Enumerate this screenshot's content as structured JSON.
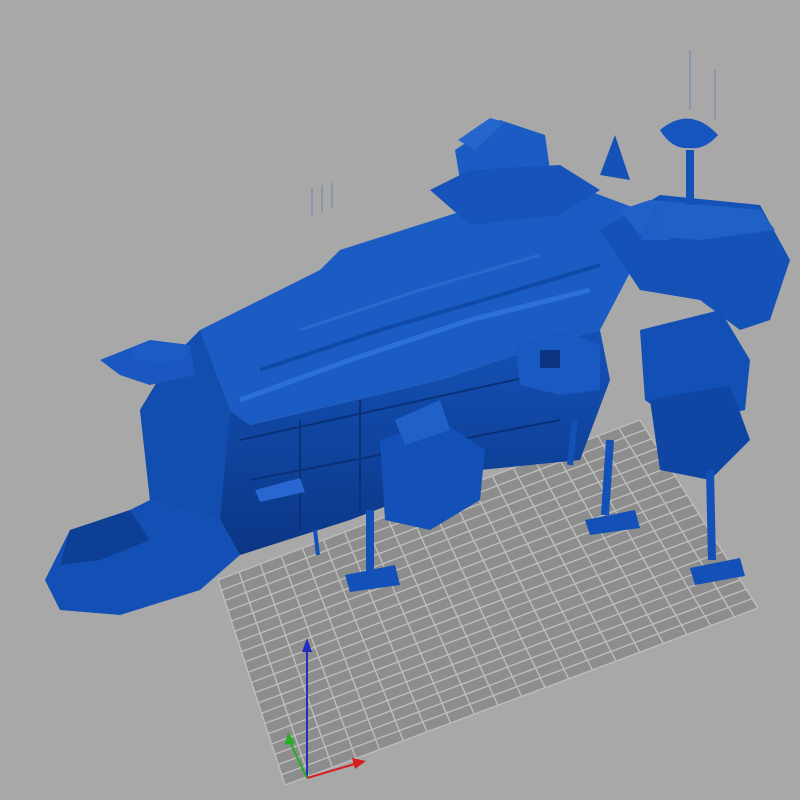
{
  "viewport": {
    "background_color": "#a8a8a8",
    "grid_color": "#8a8a8a",
    "grid_line_color": "#b9b9b9",
    "model_color": "#1351b8",
    "model_shadow_color": "#0c3a8e",
    "model_highlight_color": "#2a6ad0"
  },
  "axes": {
    "x_color": "#d42020",
    "y_color": "#20b020",
    "z_color": "#2030c0"
  }
}
